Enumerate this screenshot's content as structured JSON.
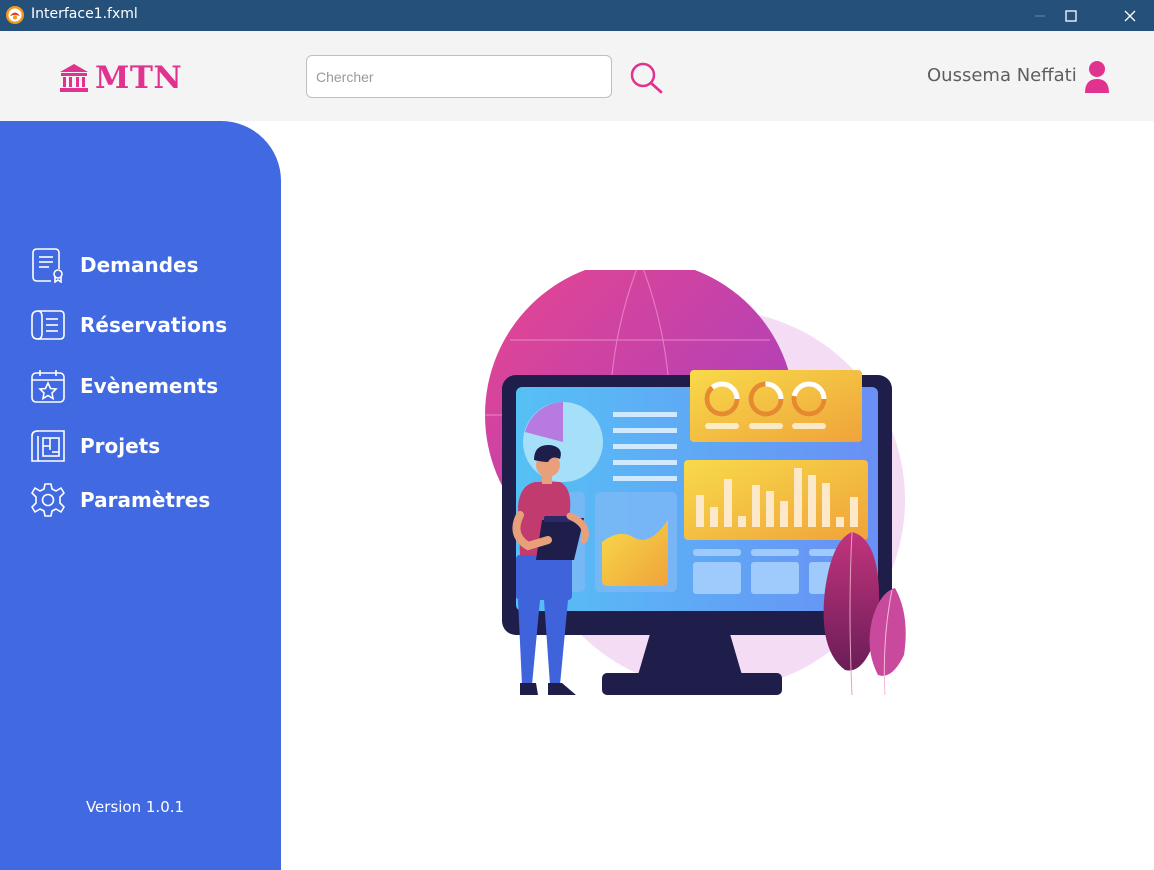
{
  "window": {
    "title": "Interface1.fxml"
  },
  "header": {
    "logo_text": "MTN",
    "search": {
      "placeholder": "Chercher",
      "value": ""
    },
    "user_name": "Oussema Neffati"
  },
  "sidebar": {
    "items": [
      {
        "label": "Demandes",
        "icon": "document-icon"
      },
      {
        "label": "Réservations",
        "icon": "list-scroll-icon"
      },
      {
        "label": "Evènements",
        "icon": "calendar-star-icon"
      },
      {
        "label": "Projets",
        "icon": "blueprint-icon"
      },
      {
        "label": "Paramètres",
        "icon": "gear-icon"
      }
    ],
    "version": "Version 1.0.1"
  },
  "colors": {
    "titlebar": "#245079",
    "header_bg": "#f4f4f4",
    "sidebar_bg": "#4169e1",
    "accent_pink": "#e0338f",
    "text_gray": "#5e5e5e"
  }
}
